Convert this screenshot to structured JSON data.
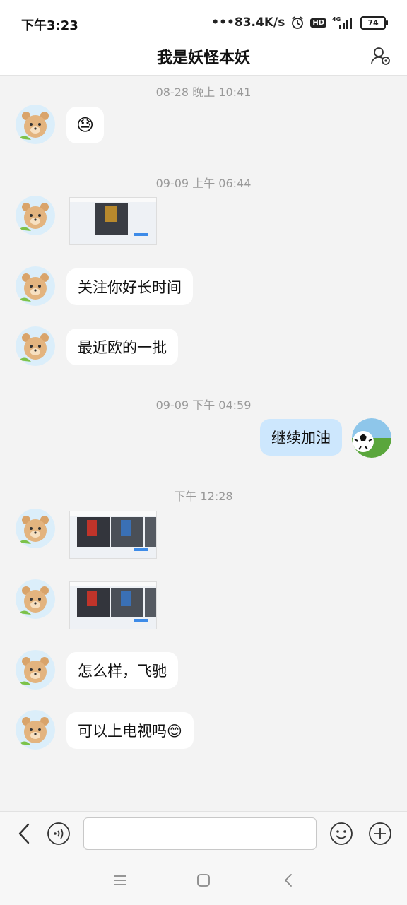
{
  "status_bar": {
    "time": "下午3:23",
    "network_speed": "•••83.4K/s",
    "network_type": "4G",
    "battery": "74"
  },
  "header": {
    "title": "我是妖怪本妖",
    "contact_settings_icon": "contact-settings-icon"
  },
  "messages": [
    {
      "type": "timestamp",
      "text": "08-28 晚上 10:41"
    },
    {
      "type": "emoji",
      "sender": "friend",
      "emoji": "😓"
    },
    {
      "type": "timestamp",
      "text": "09-09 上午 06:44"
    },
    {
      "type": "image",
      "sender": "friend",
      "description": "screenshot-thumbnail"
    },
    {
      "type": "text",
      "sender": "friend",
      "text": "关注你好长时间"
    },
    {
      "type": "text",
      "sender": "friend",
      "text": "最近欧的一批"
    },
    {
      "type": "timestamp",
      "text": "09-09 下午 04:59"
    },
    {
      "type": "text",
      "sender": "me",
      "text": "继续加油"
    },
    {
      "type": "timestamp",
      "text": "下午 12:28"
    },
    {
      "type": "image",
      "sender": "friend",
      "description": "screenshot-thumbnail"
    },
    {
      "type": "image",
      "sender": "friend",
      "description": "screenshot-thumbnail"
    },
    {
      "type": "text",
      "sender": "friend",
      "text": "怎么样，飞驰"
    },
    {
      "type": "text",
      "sender": "friend",
      "text": "可以上电视吗😊"
    }
  ],
  "input_bar": {
    "back_icon": "chevron-left-icon",
    "voice_icon": "voice-icon",
    "input_value": "",
    "emoji_icon": "smiley-icon",
    "plus_icon": "plus-icon"
  },
  "nav_bar": {
    "menu_icon": "menu-icon",
    "home_icon": "home-icon",
    "back_icon": "back-icon"
  },
  "colors": {
    "chat_background": "#f3f3f3",
    "my_bubble": "#cde7fd",
    "friend_bubble": "#ffffff"
  }
}
